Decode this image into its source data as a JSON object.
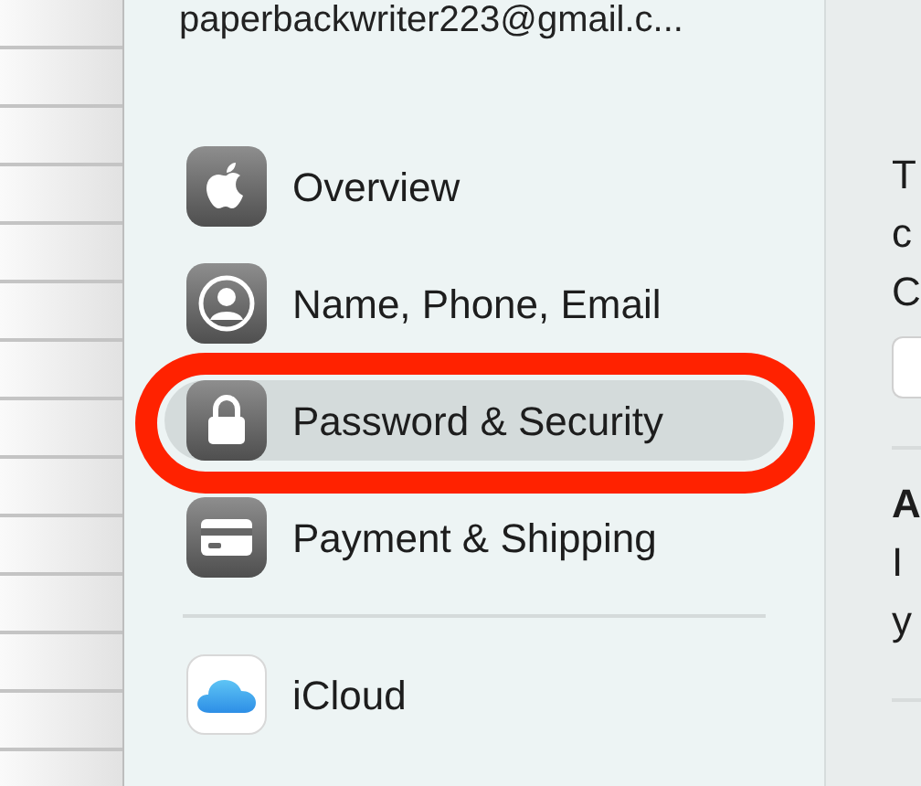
{
  "account": {
    "email": "paperbackwriter223@gmail.c..."
  },
  "sidebar": {
    "sections": [
      {
        "items": [
          {
            "label": "Overview",
            "kind": "apple",
            "selected": false
          },
          {
            "label": "Name, Phone, Email",
            "kind": "person",
            "selected": false
          },
          {
            "label": "Password & Security",
            "kind": "lock",
            "selected": true
          },
          {
            "label": "Payment & Shipping",
            "kind": "card",
            "selected": false
          }
        ]
      },
      {
        "items": [
          {
            "label": "iCloud",
            "kind": "cloud",
            "selected": false
          }
        ]
      }
    ]
  },
  "detail": {
    "blocks": [
      {
        "kind": "line",
        "text": "T"
      },
      {
        "kind": "line",
        "text": "c"
      },
      {
        "kind": "line",
        "text": "C"
      },
      {
        "kind": "field"
      },
      {
        "kind": "divider"
      },
      {
        "kind": "heading",
        "text": "A"
      },
      {
        "kind": "line",
        "text": "I"
      },
      {
        "kind": "line",
        "text": "y"
      },
      {
        "kind": "divider"
      }
    ]
  }
}
